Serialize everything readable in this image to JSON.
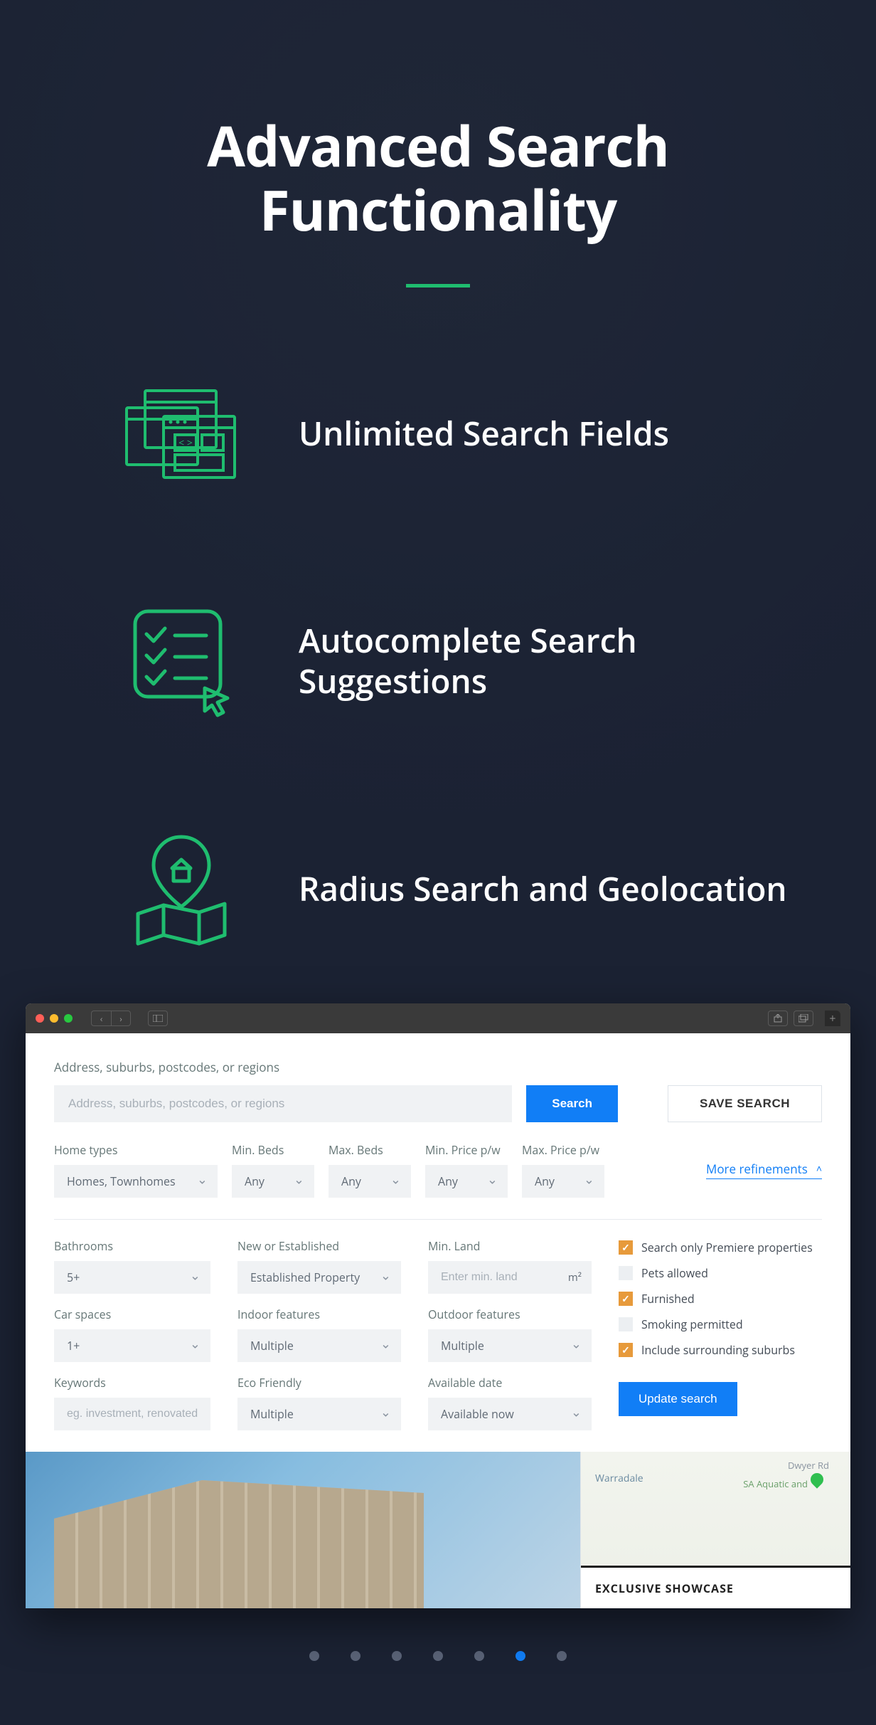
{
  "hero": {
    "title_l1": "Advanced Search",
    "title_l2": "Functionality"
  },
  "features": [
    {
      "label": "Unlimited Search Fields"
    },
    {
      "label": "Autocomplete Search Suggestions"
    },
    {
      "label": "Radius Search and Geolocation"
    }
  ],
  "form": {
    "address_label": "Address, suburbs, postcodes, or regions",
    "address_placeholder": "Address, suburbs, postcodes, or regions",
    "search_btn": "Search",
    "save_btn": "SAVE SEARCH",
    "more_link": "More refinements",
    "update_btn": "Update search",
    "row1": {
      "home_types": {
        "label": "Home types",
        "value": "Homes, Townhomes"
      },
      "min_beds": {
        "label": "Min. Beds",
        "value": "Any"
      },
      "max_beds": {
        "label": "Max. Beds",
        "value": "Any"
      },
      "min_price": {
        "label": "Min. Price p/w",
        "value": "Any"
      },
      "max_price": {
        "label": "Max. Price p/w",
        "value": "Any"
      }
    },
    "col1": {
      "bathrooms": {
        "label": "Bathrooms",
        "value": "5+"
      },
      "car_spaces": {
        "label": "Car spaces",
        "value": "1+"
      },
      "keywords": {
        "label": "Keywords",
        "placeholder": "eg. investment, renovated"
      }
    },
    "col2": {
      "new_established": {
        "label": "New or Established",
        "value": "Established Property"
      },
      "indoor": {
        "label": "Indoor features",
        "value": "Multiple"
      },
      "eco": {
        "label": "Eco Friendly",
        "value": "Multiple"
      }
    },
    "col3": {
      "min_land": {
        "label": "Min. Land",
        "placeholder": "Enter min. land",
        "unit": "m²"
      },
      "outdoor": {
        "label": "Outdoor features",
        "value": "Multiple"
      },
      "available": {
        "label": "Available date",
        "value": "Available now"
      }
    },
    "checks": [
      {
        "label": "Search only Premiere properties",
        "checked": true
      },
      {
        "label": "Pets allowed",
        "checked": false
      },
      {
        "label": "Furnished",
        "checked": true
      },
      {
        "label": "Smoking permitted",
        "checked": false
      },
      {
        "label": "Include surrounding suburbs",
        "checked": true
      }
    ]
  },
  "below": {
    "map_label_left": "Warradale",
    "map_label_top": "Dwyer Rd",
    "map_label_poi": "SA Aquatic and",
    "showcase": "EXCLUSIVE SHOWCASE"
  },
  "pager": {
    "count": 7,
    "active": 5
  }
}
